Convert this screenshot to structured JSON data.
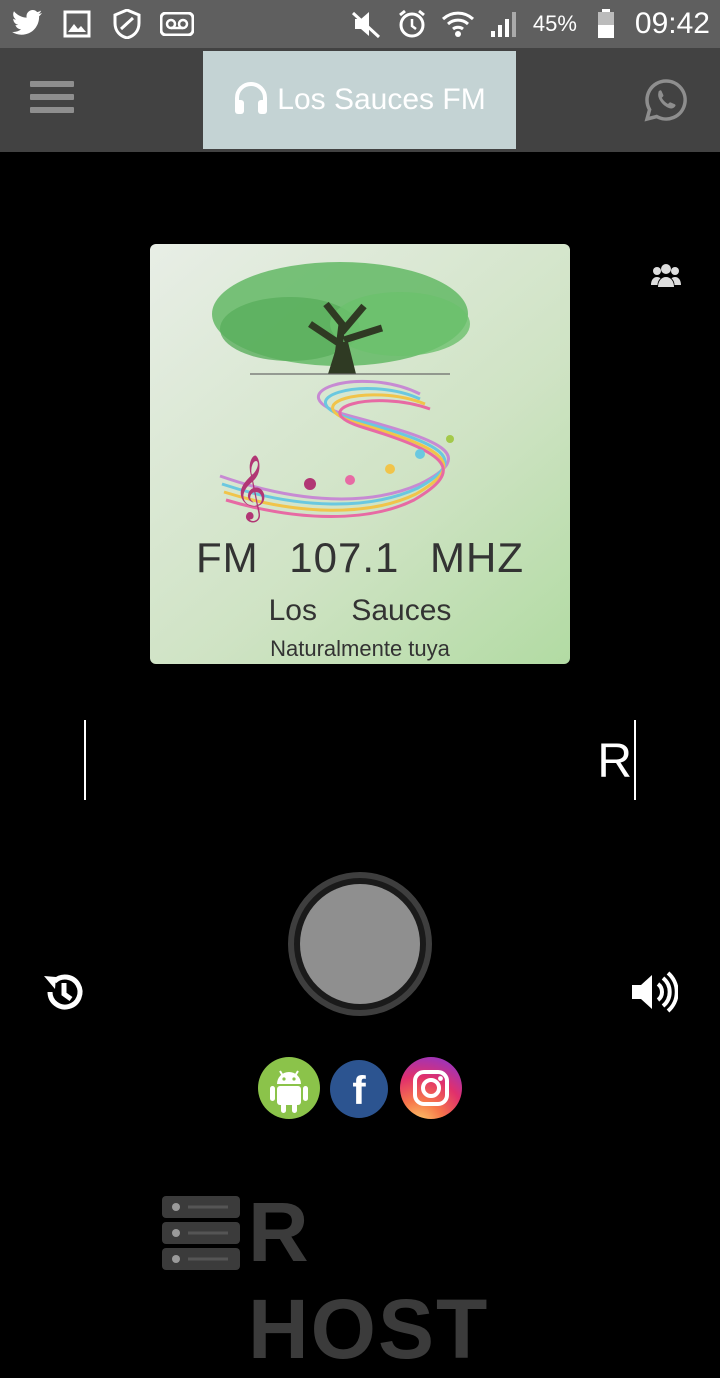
{
  "status_bar": {
    "icons_left": [
      "twitter-icon",
      "gallery-icon",
      "shield-icon",
      "voicemail-icon"
    ],
    "icons_right": [
      "mute-icon",
      "alarm-icon",
      "wifi-icon",
      "signal-icon"
    ],
    "battery": "45%",
    "time": "09:42"
  },
  "app_bar": {
    "title": "Los Sauces FM",
    "menu_icon": "hamburger-icon",
    "title_icon": "headphones-icon",
    "share_icon": "whatsapp-icon",
    "title_bg": "#c4d3d4"
  },
  "cover": {
    "line1": "FM 107.1 MHZ",
    "line2": "Los Sauces",
    "line3": "Naturalmente tuya"
  },
  "ticker": {
    "text": "R"
  },
  "controls": {
    "play_icon": "play-circle-icon",
    "history_icon": "history-icon",
    "volume_icon": "volume-icon",
    "listeners_icon": "users-icon"
  },
  "social": [
    {
      "name": "android-icon",
      "color": "#8bc34a"
    },
    {
      "name": "facebook-icon",
      "color": "#2c5490",
      "letter": "f"
    },
    {
      "name": "instagram-icon",
      "color": "#e1306c"
    }
  ],
  "footer": {
    "brand": "R HOST"
  }
}
